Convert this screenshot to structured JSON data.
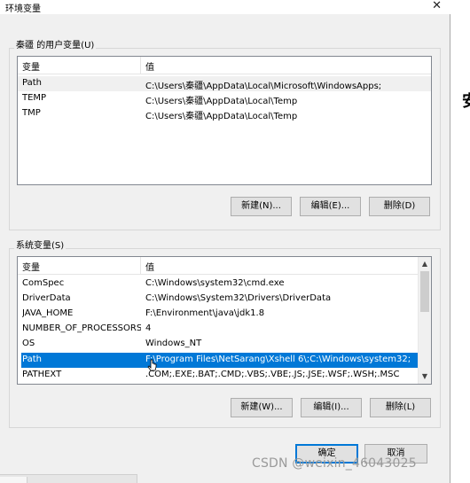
{
  "window": {
    "title": "环境变量",
    "close_glyph": "✕"
  },
  "user_vars": {
    "group_label": "秦疆 的用户变量(U)",
    "col_variable": "变量",
    "col_value": "值",
    "rows": [
      {
        "name": "Path",
        "value": "C:\\Users\\秦疆\\AppData\\Local\\Microsoft\\WindowsApps;"
      },
      {
        "name": "TEMP",
        "value": "C:\\Users\\秦疆\\AppData\\Local\\Temp"
      },
      {
        "name": "TMP",
        "value": "C:\\Users\\秦疆\\AppData\\Local\\Temp"
      }
    ],
    "new_label": "新建(N)...",
    "edit_label": "编辑(E)...",
    "delete_label": "删除(D)"
  },
  "system_vars": {
    "group_label": "系统变量(S)",
    "col_variable": "变量",
    "col_value": "值",
    "rows": [
      {
        "name": "ComSpec",
        "value": "C:\\Windows\\system32\\cmd.exe"
      },
      {
        "name": "DriverData",
        "value": "C:\\Windows\\System32\\Drivers\\DriverData"
      },
      {
        "name": "JAVA_HOME",
        "value": "F:\\Environment\\java\\jdk1.8"
      },
      {
        "name": "NUMBER_OF_PROCESSORS",
        "value": "4"
      },
      {
        "name": "OS",
        "value": "Windows_NT"
      },
      {
        "name": "Path",
        "value": "F:\\Program Files\\NetSarang\\Xshell 6\\;C:\\Windows\\system32;..."
      },
      {
        "name": "PATHEXT",
        "value": ".COM;.EXE;.BAT;.CMD;.VBS;.VBE;.JS;.JSE;.WSF;.WSH;.MSC"
      }
    ],
    "new_label": "新建(W)...",
    "edit_label": "编辑(I)...",
    "delete_label": "删除(L)"
  },
  "footer": {
    "ok_label": "确定",
    "cancel_label": "取消"
  },
  "background": {
    "side_glyph": "安"
  },
  "watermark": "CSDN @weixin_46043025",
  "colors": {
    "selection": "#0078d7",
    "dialog_bg": "#f0f0f0"
  }
}
